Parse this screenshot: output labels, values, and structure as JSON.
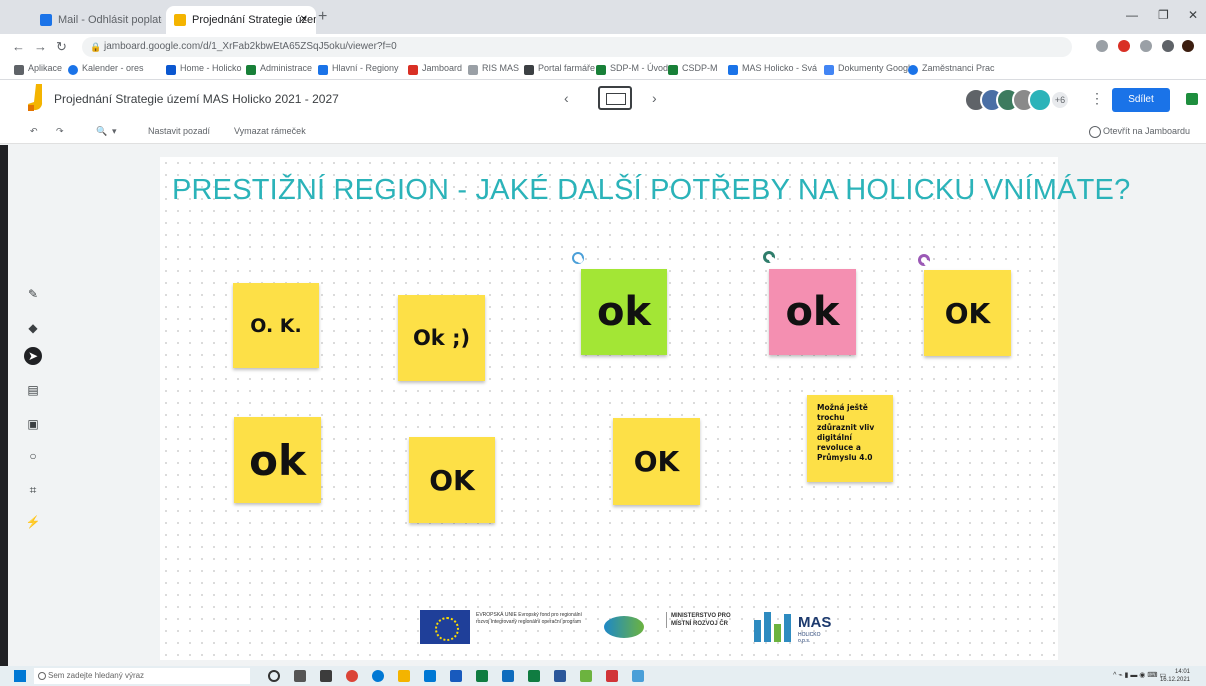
{
  "browser": {
    "tabs": [
      {
        "title": "Mail - Odhlásit poplatek",
        "color": "#1a73e8"
      },
      {
        "title": "Projednání Strategie území MA",
        "color": "#f4b400"
      }
    ],
    "url": "jamboard.google.com/d/1_XrFab2kbwEtA65ZSqJ5oku/viewer?f=0",
    "bookmarks": [
      "Aplikace",
      "Kalender - ores",
      "Home - Holicko",
      "Administrace",
      "Hlavní - Regiony",
      "Jamboard",
      "RIS MAS",
      "Portal farmáře",
      "SDP-M - Úvod",
      "CSDP-M",
      "MAS Holicko - Svá",
      "Dokumenty Google",
      "Zaměstnanci Prac"
    ]
  },
  "app": {
    "doc_title": "Projednání Strategie území MAS Holicko 2021 - 2027",
    "share_label": "Sdílet",
    "toolbar": {
      "set_background": "Nastavit pozadí",
      "clear_frame": "Vymazat rámeček",
      "open_in_jamboard": "Otevřít na Jamboardu"
    },
    "avatar_more": "+6",
    "avatar_colors": [
      "#5f6368",
      "#4a6fa5",
      "#3c7b5e",
      "#8a8a8a",
      "#2bb3b9"
    ]
  },
  "board": {
    "title": "PRESTIŽNÍ REGION - JAKÉ DALŠÍ POTŘEBY NA HOLICKU VNÍMÁTE?",
    "title_color": "#2bb3b9",
    "notes": [
      {
        "text": "O. K.",
        "color": "#fde047"
      },
      {
        "text": "Ok ;)",
        "color": "#fde047"
      },
      {
        "text": "ok",
        "color": "#a3e635"
      },
      {
        "text": "ok",
        "color": "#f48fb1"
      },
      {
        "text": "OK",
        "color": "#fde047"
      },
      {
        "text": "ok",
        "color": "#fde047"
      },
      {
        "text": "OK",
        "color": "#fde047"
      },
      {
        "text": "OK",
        "color": "#fde047"
      },
      {
        "text": "Možná ještě trochu zdůraznit vliv digitální revoluce a Průmyslu 4.0",
        "color": "#fde047"
      }
    ],
    "pins": [
      {
        "color": "#4a9fd8"
      },
      {
        "color": "#2f7d6b"
      },
      {
        "color": "#9b59b6"
      }
    ],
    "logos": {
      "eu_text": "EVROPSKÁ UNIE Evropský fond pro regionální rozvoj Integrovaný regionální operační program",
      "ministry_text": "MINISTERSTVO PRO MÍSTNÍ ROZVOJ ČR",
      "mas_name": "MAS",
      "mas_sub": "HOLICKO o.p.s."
    }
  },
  "taskbar": {
    "search_placeholder": "Sem zadejte hledaný výraz",
    "clock_time": "14:01",
    "clock_date": "16.12.2021"
  }
}
